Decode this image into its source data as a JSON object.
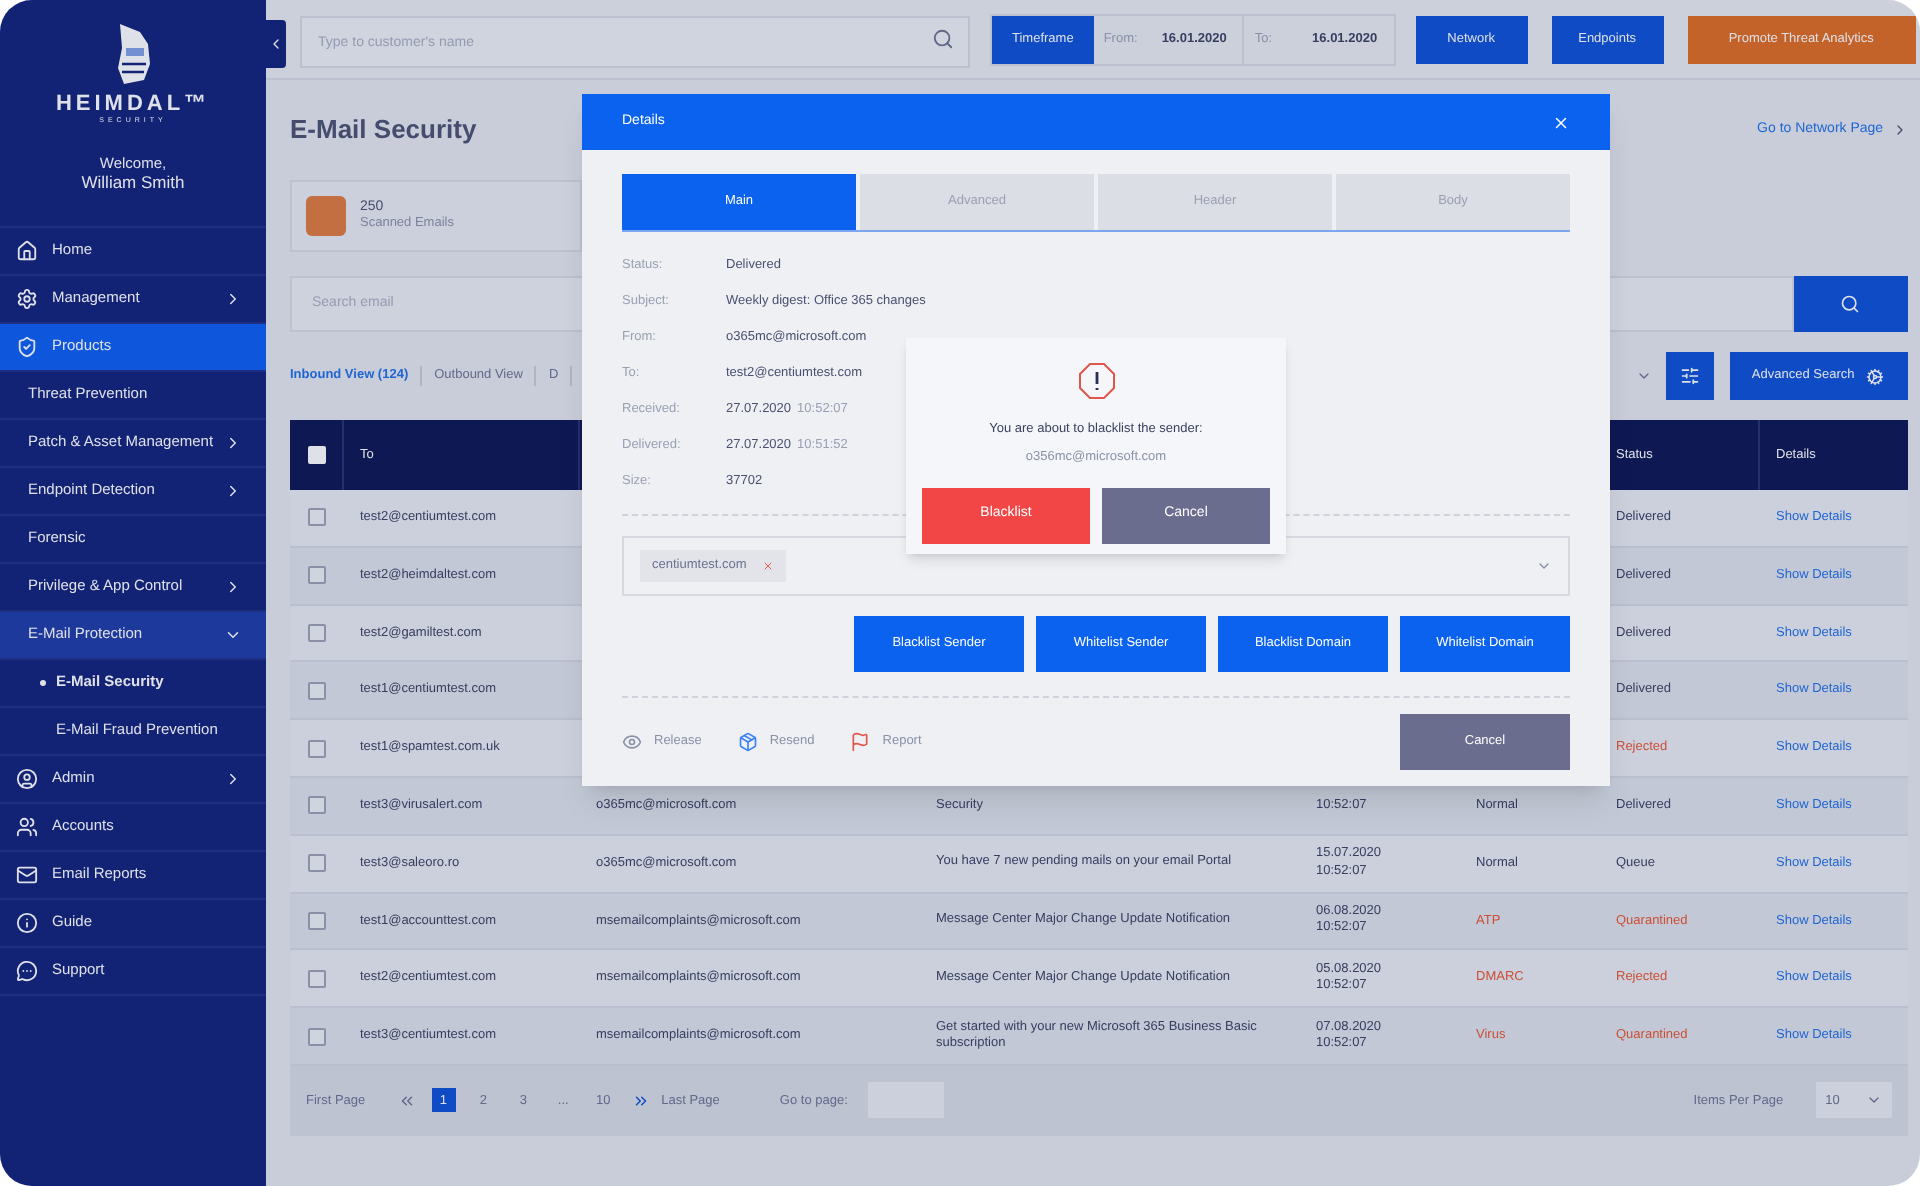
{
  "sidebar": {
    "brand": "HEIMDAL™",
    "brand_sub": "SECURITY",
    "welcome": "Welcome,",
    "user": "William Smith",
    "items": [
      {
        "label": "Home",
        "selected": false
      },
      {
        "label": "Management",
        "selected": false,
        "expanded": false
      },
      {
        "label": "Products",
        "selected": true,
        "children": [
          {
            "label": "Threat Prevention",
            "selected": false
          },
          {
            "label": "Patch & Asset Management",
            "selected": false,
            "expanded": false
          },
          {
            "label": "Endpoint Detection",
            "selected": false,
            "expanded": false
          },
          {
            "label": "Forensic",
            "selected": false
          },
          {
            "label": "Privilege & App Control",
            "selected": false,
            "expanded": false
          },
          {
            "label": "E-Mail Protection",
            "selected": false,
            "expanded": true,
            "children": [
              {
                "label": "E-Mail Security",
                "selected": true
              },
              {
                "label": "E-Mail Fraud Prevention",
                "selected": false
              }
            ]
          }
        ]
      },
      {
        "label": "Admin",
        "selected": false,
        "expanded": false
      },
      {
        "label": "Accounts",
        "selected": false
      },
      {
        "label": "Email Reports",
        "selected": false
      },
      {
        "label": "Guide",
        "selected": false
      },
      {
        "label": "Support",
        "selected": false
      }
    ]
  },
  "topbar": {
    "search_placeholder": "Type to customer's name",
    "timeframe": "Timeframe",
    "from_label": "From:",
    "from_value": "16.01.2020",
    "to_label": "To:",
    "to_value": "16.01.2020",
    "buttons": [
      {
        "label": "Network",
        "kind": "primary"
      },
      {
        "label": "Endpoints",
        "kind": "primary"
      },
      {
        "label": "Promote Threat Analytics",
        "kind": "accent"
      }
    ]
  },
  "page": {
    "title": "E-Mail Security",
    "link": "Go to Network Page",
    "stat": {
      "value": "250",
      "label": "Scanned Emails"
    },
    "search_placeholder": "Search email",
    "views": [
      {
        "label": "Inbound View (124)",
        "selected": true
      },
      {
        "label": "Outbound View",
        "selected": false
      },
      {
        "label": "D",
        "selected": false
      }
    ],
    "advanced_search": "Advanced Search"
  },
  "table": {
    "header": {
      "checked": false,
      "to": "To",
      "status": "Status",
      "details": "Details"
    },
    "rows": [
      {
        "checked": false,
        "to": "test2@centiumtest.com",
        "status": "Delivered",
        "status_alert": false,
        "details": "Show Details"
      },
      {
        "checked": false,
        "to": "test2@heimdaltest.com",
        "status": "Delivered",
        "status_alert": false,
        "details": "Show Details"
      },
      {
        "checked": false,
        "to": "test2@gamiltest.com",
        "status": "Delivered",
        "status_alert": false,
        "details": "Show Details"
      },
      {
        "checked": false,
        "to": "test1@centiumtest.com",
        "status": "Delivered",
        "status_alert": false,
        "details": "Show Details"
      },
      {
        "checked": false,
        "to": "test1@spamtest.com.uk",
        "status": "Rejected",
        "status_alert": true,
        "details": "Show Details"
      },
      {
        "checked": false,
        "to": "test3@virusalert.com",
        "from": "o365mc@microsoft.com",
        "subject": "Security",
        "time": "10:52:07",
        "type": "Normal",
        "type_alert": false,
        "status": "Delivered",
        "status_alert": false,
        "details": "Show Details"
      },
      {
        "checked": false,
        "to": "test3@saleoro.ro",
        "from": "o365mc@microsoft.com",
        "subject": "You have 7 new pending mails on your email Portal",
        "date": "15.07.2020",
        "time": "10:52:07",
        "type": "Normal",
        "type_alert": false,
        "status": "Queue",
        "status_alert": false,
        "details": "Show Details"
      },
      {
        "checked": false,
        "to": "test1@accounttest.com",
        "from": "msemailcomplaints@microsoft.com",
        "subject": "Message Center Major Change Update Notification",
        "date": "06.08.2020",
        "time": "10:52:07",
        "type": "ATP",
        "type_alert": true,
        "status": "Quarantined",
        "status_alert": true,
        "details": "Show Details"
      },
      {
        "checked": false,
        "to": "test2@centiumtest.com",
        "from": "msemailcomplaints@microsoft.com",
        "subject": "Message Center Major Change Update Notification",
        "date": "05.08.2020",
        "time": "10:52:07",
        "type": "DMARC",
        "type_alert": true,
        "status": "Rejected",
        "status_alert": true,
        "details": "Show Details"
      },
      {
        "checked": false,
        "to": "test3@centiumtest.com",
        "from": "msemailcomplaints@microsoft.com",
        "subject": "Get started with your new Microsoft 365 Business Basic subscription",
        "date": "07.08.2020",
        "time": "10:52:07",
        "type": "Virus",
        "type_alert": true,
        "status": "Quarantined",
        "status_alert": true,
        "details": "Show Details"
      }
    ]
  },
  "pagination": {
    "first": "First Page",
    "pages": [
      {
        "label": "1",
        "selected": true
      },
      {
        "label": "2",
        "selected": false
      },
      {
        "label": "3",
        "selected": false
      },
      {
        "label": "...",
        "selected": false
      },
      {
        "label": "10",
        "selected": false
      }
    ],
    "last": "Last Page",
    "goto": "Go to page:",
    "per_page_label": "Items Per Page",
    "per_page": "10"
  },
  "modal": {
    "title": "Details",
    "tabs": [
      {
        "label": "Main",
        "selected": true
      },
      {
        "label": "Advanced",
        "selected": false
      },
      {
        "label": "Header",
        "selected": false
      },
      {
        "label": "Body",
        "selected": false
      }
    ],
    "fields": [
      {
        "label": "Status:",
        "value": "Delivered"
      },
      {
        "label": "Subject:",
        "value": "Weekly digest: Office 365 changes"
      },
      {
        "label": "From:",
        "value": "o365mc@microsoft.com"
      },
      {
        "label": "To:",
        "value": "test2@centiumtest.com"
      },
      {
        "label": "Received:",
        "value": "27.07.2020",
        "extra": "10:52:07"
      },
      {
        "label": "Delivered:",
        "value": "27.07.2020",
        "extra": "10:51:52"
      },
      {
        "label": "Size:",
        "value": "37702"
      }
    ],
    "tags": [
      "centiumtest.com"
    ],
    "actions": [
      "Blacklist Sender",
      "Whitelist Sender",
      "Blacklist Domain",
      "Whitelist Domain"
    ],
    "footer_links": [
      "Release",
      "Resend",
      "Report"
    ],
    "cancel": "Cancel"
  },
  "confirm": {
    "message": "You are about to blacklist the sender:",
    "email": "o356mc@microsoft.com",
    "confirm": "Blacklist",
    "cancel": "Cancel"
  }
}
